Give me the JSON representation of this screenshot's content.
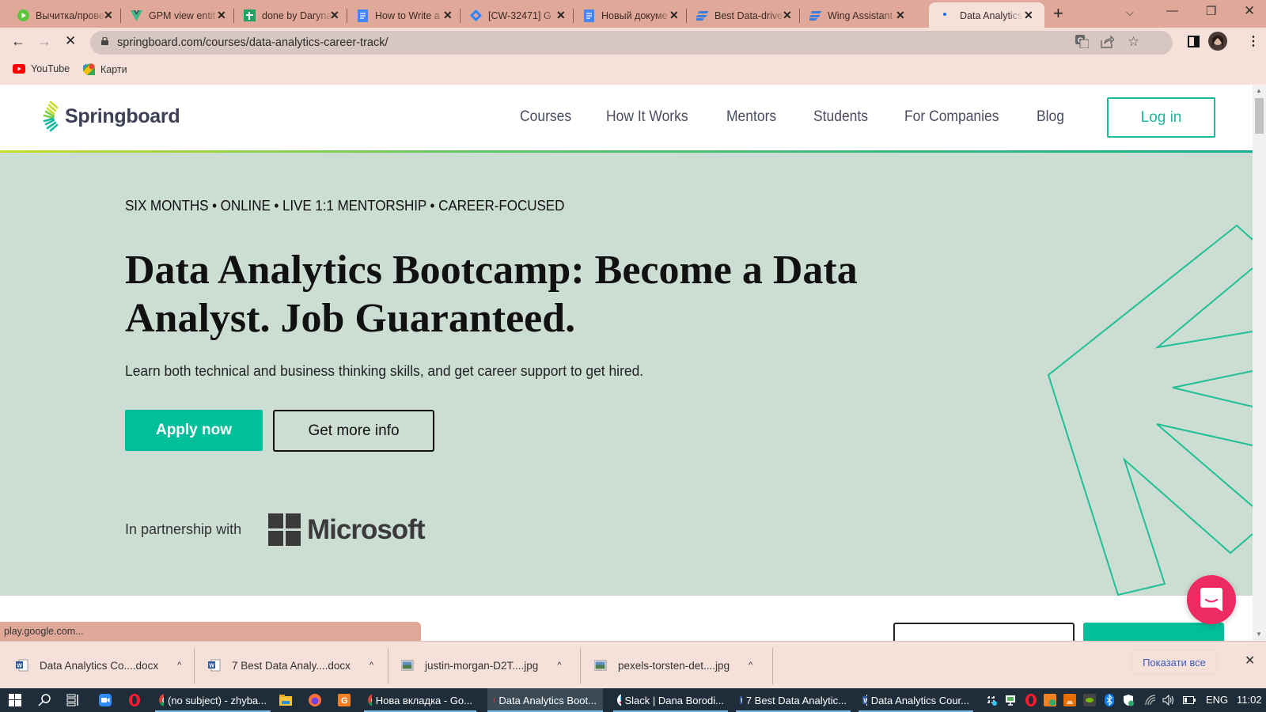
{
  "browser": {
    "tabs": [
      {
        "title": "Вычитка/прове",
        "icon": "play-icon",
        "color": "#5ac43a"
      },
      {
        "title": "GPM view entit",
        "icon": "vue-icon",
        "color": "#3fb883"
      },
      {
        "title": "done by Daryna",
        "icon": "sheets-icon",
        "color": "#1ea362"
      },
      {
        "title": "How to Write a",
        "icon": "docs-icon",
        "color": "#4285f4"
      },
      {
        "title": "[CW-32471] G",
        "icon": "jira-icon",
        "color": "#2684ff"
      },
      {
        "title": "Новый докуме",
        "icon": "docs-icon",
        "color": "#4285f4"
      },
      {
        "title": "Best Data-drive",
        "icon": "wing-icon",
        "color": "#3b7ddd"
      },
      {
        "title": "Wing Assistant",
        "icon": "wing-icon",
        "color": "#3b7ddd"
      },
      {
        "title": "Data Analytics",
        "icon": "loading-icon",
        "color": "#1a73e8",
        "active": true
      }
    ],
    "url": "springboard.com/courses/data-analytics-career-track/",
    "bookmarks": [
      {
        "label": "YouTube",
        "icon": "youtube-icon"
      },
      {
        "label": "Карти",
        "icon": "maps-icon"
      }
    ],
    "status_url": "play.google.com..."
  },
  "site": {
    "brand": "Springboard",
    "nav": [
      "Courses",
      "How It Works",
      "Mentors",
      "Students",
      "For Companies",
      "Blog"
    ],
    "login_label": "Log in",
    "accent_color": "#00bf9a",
    "hero": {
      "eyebrow": "SIX MONTHS • ONLINE • LIVE 1:1 MENTORSHIP • CAREER-FOCUSED",
      "headline": "Data Analytics Bootcamp: Become a Data Analyst. Job Guaranteed.",
      "subhead": "Learn both technical and business thinking skills, and get career support to get hired.",
      "apply_label": "Apply now",
      "info_label": "Get more info",
      "partner_label": "In partnership with",
      "partner_name": "Microsoft"
    }
  },
  "downloads": {
    "items": [
      {
        "name": "Data Analytics Co....docx",
        "type": "word"
      },
      {
        "name": "7 Best Data Analy....docx",
        "type": "word"
      },
      {
        "name": "justin-morgan-D2T....jpg",
        "type": "image"
      },
      {
        "name": "pexels-torsten-det....jpg",
        "type": "image"
      }
    ],
    "show_all_label": "Показати все"
  },
  "taskbar": {
    "apps": [
      {
        "label": "(no subject) - zhyba...",
        "icon": "chrome-icon"
      },
      {
        "label": "Нова вкладка - Go...",
        "icon": "chrome-icon"
      },
      {
        "label": "Data Analytics Boot...",
        "icon": "chrome-icon",
        "active": true
      },
      {
        "label": "Slack | Dana Borodi...",
        "icon": "slack-icon"
      },
      {
        "label": "7 Best Data Analytic...",
        "icon": "word-icon"
      },
      {
        "label": "Data Analytics Cour...",
        "icon": "word-icon"
      }
    ],
    "language": "ENG",
    "time": "11:02"
  }
}
